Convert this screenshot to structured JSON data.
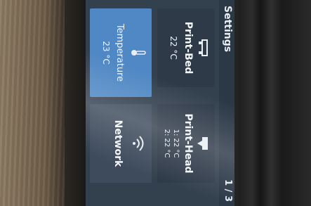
{
  "header": {
    "title": "Settings",
    "page": "1 / 3"
  },
  "tiles": {
    "print_bed": {
      "label": "Print-Bed",
      "value": "22 °C",
      "icon": "bed-icon"
    },
    "temperature": {
      "label": "Temperature",
      "value": "23 °C",
      "icon": "thermometer-icon"
    },
    "print_head": {
      "label": "Print-Head",
      "line1": "1:  22 °C",
      "line2": "2:  22 °C",
      "icon": "nozzle-icon"
    },
    "network": {
      "label": "Network",
      "icon": "wifi-icon"
    }
  }
}
